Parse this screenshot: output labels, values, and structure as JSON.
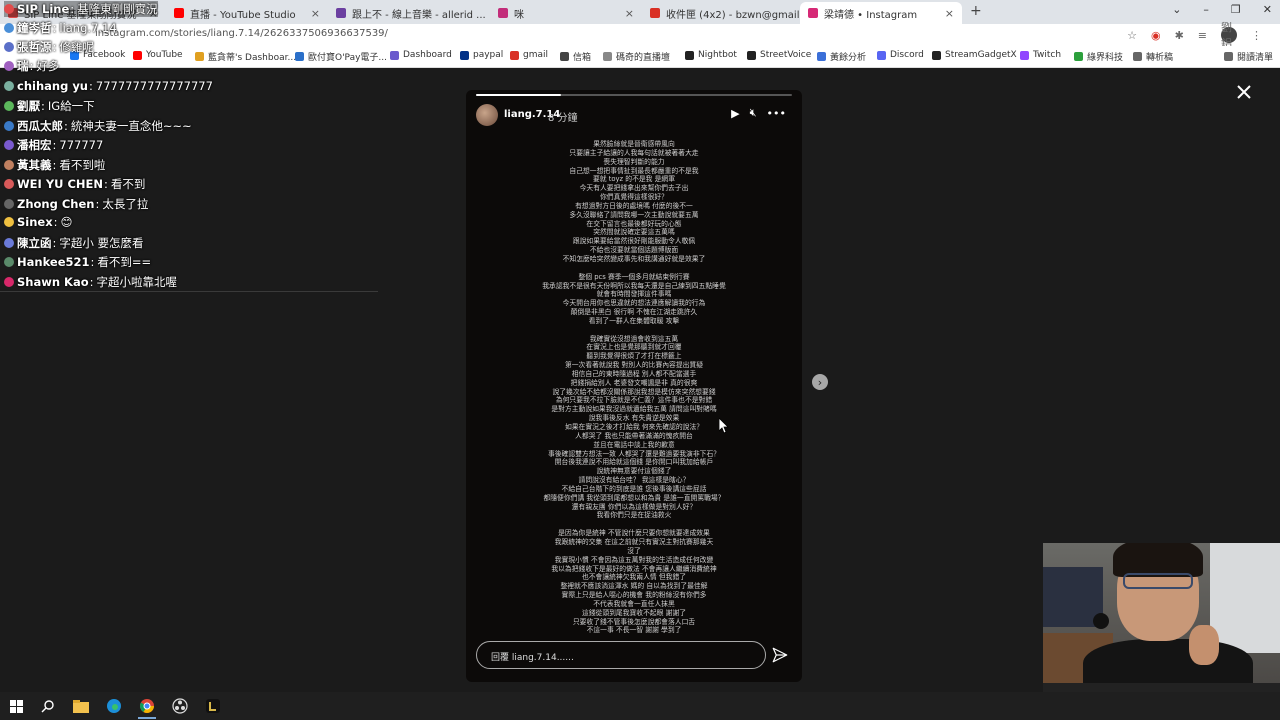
{
  "browser": {
    "tabs": [
      {
        "title": "SIP Line 基隆東剛剛實況",
        "fav_color": "#e24b4b",
        "active": false
      },
      {
        "title": "直播 - YouTube Studio",
        "fav_color": "#ff0000",
        "active": false
      },
      {
        "title": "跟上不 - 線上音樂 - allerid ...",
        "fav_color": "#6b3fa0",
        "active": false
      },
      {
        "title": "咪",
        "fav_color": "#c22d7a",
        "active": false
      },
      {
        "title": "收件匣 (4x2) - bzwn@gmail...",
        "fav_color": "#d93025",
        "active": false
      },
      {
        "title": "梁靖德 • Instagram",
        "fav_color": "#d62976",
        "active": true
      }
    ],
    "new_tab_label": "+",
    "url": "instagram.com/stories/liang.7.14/2626337506936637539/",
    "profile_label": "劉鋁",
    "bookmarks": [
      {
        "label": "Facebook",
        "color": "#1877f2"
      },
      {
        "label": "YouTube",
        "color": "#ff0000"
      },
      {
        "label": "藍貪蒂's Dashboar...",
        "color": "#e0a020"
      },
      {
        "label": "歐付寶O'Pay電子...",
        "color": "#2a6fc9"
      },
      {
        "label": "Dashboard",
        "color": "#6a5acd"
      },
      {
        "label": "paypal",
        "color": "#003087"
      },
      {
        "label": "gmail",
        "color": "#d93025"
      },
      {
        "label": "信箱",
        "color": "#444"
      },
      {
        "label": "碼奇的直播壇",
        "color": "#888"
      },
      {
        "label": "Nightbot",
        "color": "#222"
      },
      {
        "label": "StreetVoice",
        "color": "#222"
      },
      {
        "label": "黃餘分析",
        "color": "#3b6fd8"
      },
      {
        "label": "Discord",
        "color": "#5865f2"
      },
      {
        "label": "StreamGadgetX",
        "color": "#222"
      },
      {
        "label": "Twitch",
        "color": "#9146ff"
      },
      {
        "label": "綠界科技",
        "color": "#2ca03c"
      },
      {
        "label": "轉析稿",
        "color": "#666"
      },
      {
        "label": "閱讀清單",
        "color": "#666"
      }
    ]
  },
  "chat": {
    "overlay_top": [
      {
        "name": "SIP Line",
        "message": "基隆東剛剛實況",
        "color": "#e24b4b"
      },
      {
        "name": "鐘岑哲",
        "message": "liang.7.14",
        "color": "#4a8fd8"
      },
      {
        "name": "張哲源",
        "message": "修雞呢",
        "color": "#5a6fc8"
      },
      {
        "name": "瑞",
        "message": "好多",
        "color": "#a060c0"
      }
    ],
    "messages": [
      {
        "name": "chihang yu",
        "message": "7777777777777777",
        "color": "#7ab0a0"
      },
      {
        "name": "劉厭",
        "message": "IG給一下",
        "color": "#5cb85c"
      },
      {
        "name": "西瓜太郎",
        "message": "統神夫妻一直念他~~~",
        "color": "#3a7ac8"
      },
      {
        "name": "潘相宏",
        "message": "777777",
        "color": "#7a5ad0"
      },
      {
        "name": "黃其義",
        "message": "看不到啦",
        "color": "#c08060"
      },
      {
        "name": "WEI YU CHEN",
        "message": "看不到",
        "color": "#d85a5a"
      },
      {
        "name": "Zhong Chen",
        "message": "太長了拉",
        "color": "#666"
      },
      {
        "name": "Sinex",
        "message": "😊",
        "color": "#f0c040"
      },
      {
        "name": "陳立函",
        "message": "字超小 要怎麼看",
        "color": "#6a7ad8"
      },
      {
        "name": "Hankee521",
        "message": "看不到==",
        "color": "#5a8a6a"
      },
      {
        "name": "Shawn Kao",
        "message": "字超小啦靠北喔",
        "color": "#d8286a"
      }
    ]
  },
  "story": {
    "username": "liang.7.14",
    "time_ago": "8 分鐘",
    "progress": 0.27,
    "reply_placeholder": "回覆 liang.7.14......",
    "lines": [
      "果然臉絲就是晉衛感帶風向",
      "只要讓主子給讓的人我每句話就被著著大走",
      "喪失理智判斷的能力",
      "自己想一想把事情扯到最長都嚴重的不是我",
      "要就 toyz 的不是我 是網軍",
      "今天有人要把錢拿出來幫你們去子出",
      "你們真覺得這樣很好？",
      "有想過對方日後的處境嗎 付麼的後不一",
      "多久沒聯絡了請問我哪一次主動說就要五萬",
      "在交下留言也最後都好玩的心態",
      "突然間就說確定要這五萬嗎",
      "跟說如果要給當然很好剛能服動令人敬佩",
      "不給也沒要就當個話題博版面",
      "不知怎麼哈突然變成事先和我講通好就是效果了",
      "",
      "整個 pcs 賽季一個多月就結束例行賽",
      "我承認我不是很有天份啊所以我每天還是自己練到四五點睡覺",
      "就會有時間發揮這件事嗎",
      "今天開台用你也思違就的想法連應解讀我的行為",
      "顛倒是非黑白 很行啊 不愧在江湖走跳許久",
      "看到了一群人在集體取暖 攻擊",
      "",
      "我確實從沒想過會收到這五萬",
      "在實況上也是覺那聽到就才回覆",
      "聽到我覺得很煩了才打在標籤上",
      "第一次看著就說我 對別人的比賽內容提出質疑",
      "相信自己的東時隨過程 別人都不配當選手",
      "把錢捐給別人 老婆發文嘲諷是非 真的很爽",
      "說了幾次給不給都沒關係那說我想是模仿來突然想要錢",
      "為何只要我不拉下臉就是不仁義？這件事也不是對錯",
      "是對方主動說如果我沒過就遺給我五萬 請問這叫對賭嗎",
      "說我事後反水 有失貴逆是效果",
      "如果在實況之後才打給我 何來先確認的說法？",
      "人都哭了 我也只能帶著滿滿的愧疚開台",
      "並且在電話中談上我的歉意",
      "事後確認雙方想法一致 人都哭了還是難過要我演非下石？",
      "開台後我連說不用給就這個錢 是你開口叫我加給帳戶",
      "說統神無意要付這個錢了",
      "請問說沒有給台哇？ 我這樣是瞎心？",
      "不給自己台階下的到底是誰 您後事後講這些屁話",
      "都隨便你們講 我從頭到尾都想以和為貴 是誰一直開罵戰場？",
      "還有親友團 你們以為這樣做是對別人好？",
      "我看你們只是在捉油救火",
      "",
      "是因為你是統神 不管說什麼只要你想就要達成效果",
      "我跟統神的交集 在這之前就只有實況主對抗賽那幾天",
      "沒了",
      "我實現小慣 不會因為這五萬對我的生活造成任何改變",
      "我以為把錢收下是最好的做法 不會再讓人繼續消費統神",
      "也不會讓統神欠我兩人情 但我錯了",
      "整裡就不應該淌這渾水 媽的 自以為找到了最佳解",
      "實際上只是給人噁心的機會 我的粉絲沒有你們多",
      "不代表我就會一直任人抹黑",
      "這錢從頭到尾我寶收不起眼 謝謝了",
      "只要收了錢不管事後怎麼說都會落人口舌",
      "不這一事 不長一智 謝謝 學到了"
    ]
  },
  "taskbar": {
    "items": [
      "windows-start",
      "search",
      "file-explorer",
      "edge",
      "chrome",
      "obs",
      "streamlabs"
    ]
  }
}
